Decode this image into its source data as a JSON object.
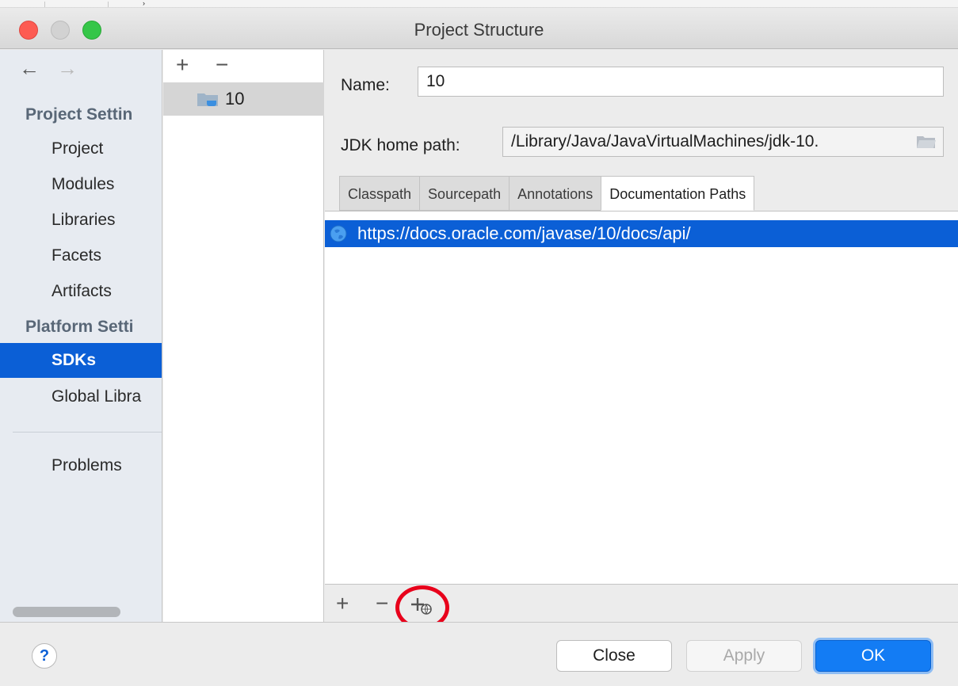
{
  "window": {
    "title": "Project Structure"
  },
  "leftnav": {
    "back_icon": "arrow-left-icon",
    "forward_icon": "arrow-right-icon",
    "back_glyph": "←",
    "forward_glyph": "→",
    "sections": [
      {
        "title": "Project Settin",
        "items": [
          "Project",
          "Modules",
          "Libraries",
          "Facets",
          "Artifacts"
        ]
      },
      {
        "title": "Platform Setti",
        "items": [
          "SDKs",
          "Global Libra"
        ]
      }
    ],
    "selected": "SDKs",
    "problems": "Problems"
  },
  "sdk_list": {
    "add": "+",
    "remove": "−",
    "items": [
      {
        "label": "10",
        "icon": "jdk-folder-icon"
      }
    ]
  },
  "main": {
    "name_label": "Name:",
    "name_value": "10",
    "jdk_label": "JDK home path:",
    "jdk_value": "/Library/Java/JavaVirtualMachines/jdk-10.",
    "tabs": [
      "Classpath",
      "Sourcepath",
      "Annotations",
      "Documentation Paths"
    ],
    "active_tab": "Documentation Paths",
    "paths": [
      {
        "url": "https://docs.oracle.com/javase/10/docs/api/",
        "icon": "globe-icon"
      }
    ],
    "toolbar": {
      "add": "+",
      "remove": "−",
      "add_url_icon": "add-web-url-icon"
    }
  },
  "footer": {
    "help": "?",
    "close": "Close",
    "apply": "Apply",
    "ok": "OK"
  },
  "colors": {
    "selection": "#0b5fd6",
    "ok_button": "#137cf4",
    "callout": "#e8001b"
  }
}
